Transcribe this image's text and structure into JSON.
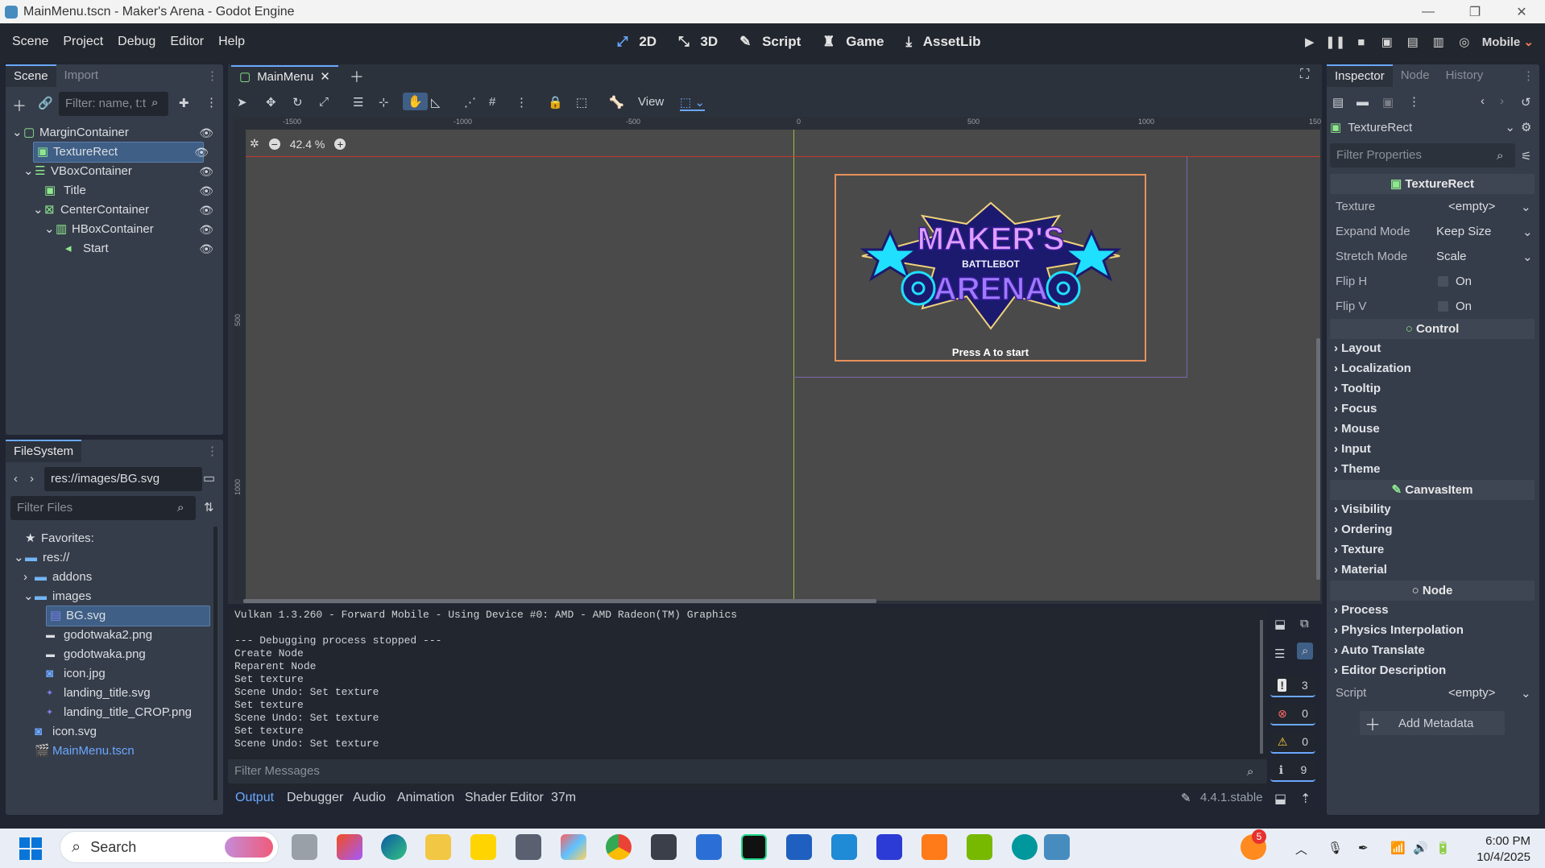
{
  "window": {
    "title": "MainMenu.tscn - Maker's Arena - Godot Engine"
  },
  "menubar": {
    "menus": [
      "Scene",
      "Project",
      "Debug",
      "Editor",
      "Help"
    ],
    "modes": [
      "2D",
      "3D",
      "Script",
      "Game",
      "AssetLib"
    ],
    "renderer": "Mobile"
  },
  "scene_dock": {
    "tabs": [
      "Scene",
      "Import"
    ],
    "filter_placeholder": "Filter: name, t:t",
    "nodes": [
      "MarginContainer",
      "TextureRect",
      "VBoxContainer",
      "Title",
      "CenterContainer",
      "HBoxContainer",
      "Start"
    ]
  },
  "filesystem": {
    "tab": "FileSystem",
    "path": "res://images/BG.svg",
    "filter_placeholder": "Filter Files",
    "items": [
      "Favorites:",
      "res://",
      "addons",
      "images",
      "BG.svg",
      "godotwaka2.png",
      "godotwaka.png",
      "icon.jpg",
      "landing_title.svg",
      "landing_title_CROP.png",
      "icon.svg",
      "MainMenu.tscn"
    ]
  },
  "editor": {
    "tab": "MainMenu",
    "view_label": "View",
    "zoom": "42.4 %",
    "ruler_ticks": [
      "-1500",
      "-1000",
      "-500",
      "0",
      "500",
      "1000",
      "150"
    ],
    "ruler_left_ticks": [
      "500",
      "1000"
    ],
    "logo_line1": "MAKER'S",
    "logo_line2": "BATTLEBOT",
    "logo_line3": "ARENA",
    "press_label": "Press A to start"
  },
  "output": {
    "lines": [
      "Vulkan 1.3.260 - Forward Mobile - Using Device #0: AMD - AMD Radeon(TM) Graphics",
      "",
      "--- Debugging process stopped ---",
      "Create Node",
      "Reparent Node",
      "Set texture",
      "Scene Undo: Set texture",
      "Set texture",
      "Scene Undo: Set texture",
      "Set texture",
      "Scene Undo: Set texture"
    ],
    "filter_placeholder": "Filter Messages",
    "counts": {
      "messages": "3",
      "errors": "0",
      "warnings": "0",
      "info": "9"
    }
  },
  "bottom_tabs": [
    "Output",
    "Debugger",
    "Audio",
    "Animation",
    "Shader Editor",
    "37m"
  ],
  "version": "4.4.1.stable",
  "inspector": {
    "tabs": [
      "Inspector",
      "Node",
      "History"
    ],
    "object": "TextureRect",
    "filter_placeholder": "Filter Properties",
    "section_texturerect": "TextureRect",
    "props": {
      "texture_label": "Texture",
      "texture_val": "<empty>",
      "expand_label": "Expand Mode",
      "expand_val": "Keep Size",
      "stretch_label": "Stretch Mode",
      "stretch_val": "Scale",
      "fliph_label": "Flip H",
      "fliph_val": "On",
      "flipv_label": "Flip V",
      "flipv_val": "On"
    },
    "section_control": "Control",
    "control_groups": [
      "Layout",
      "Localization",
      "Tooltip",
      "Focus",
      "Mouse",
      "Input",
      "Theme"
    ],
    "section_canvasitem": "CanvasItem",
    "canvas_groups": [
      "Visibility",
      "Ordering",
      "Texture",
      "Material"
    ],
    "section_node": "Node",
    "node_groups": [
      "Process",
      "Physics Interpolation",
      "Auto Translate",
      "Editor Description"
    ],
    "script_label": "Script",
    "script_val": "<empty>",
    "add_metadata": "Add Metadata"
  },
  "taskbar": {
    "search": "Search",
    "time": "6:00 PM",
    "date": "10/4/2025",
    "badge": "5"
  },
  "colors": {
    "accent": "#6aa8ff",
    "panel": "#363d4a",
    "viewport": "#4a4a4a",
    "selection_box": "#e8915a",
    "mobile": "#ee7b58"
  }
}
